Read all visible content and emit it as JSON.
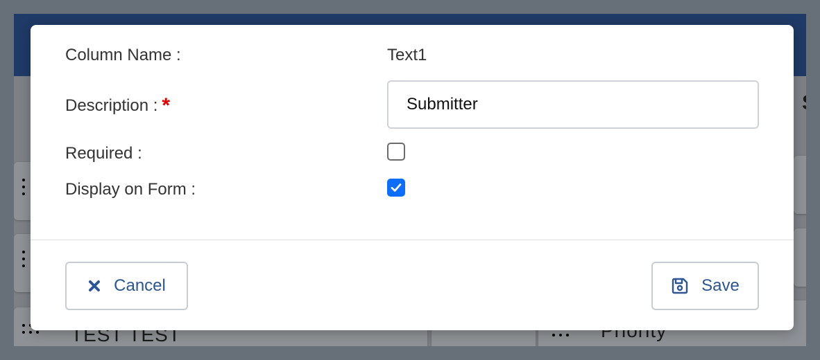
{
  "background": {
    "row_text_1": "TEST TEST",
    "row_text_2": "Priority",
    "partial_letter": "S"
  },
  "modal": {
    "column_name": {
      "label": "Column Name :",
      "value": "Text1"
    },
    "description": {
      "label": "Description :",
      "required_marker": "*",
      "value": "Submitter"
    },
    "required": {
      "label": "Required :",
      "checked": false
    },
    "display_on_form": {
      "label": "Display on Form :",
      "checked": true
    },
    "footer": {
      "cancel_label": "Cancel",
      "cancel_icon": "times-icon",
      "save_label": "Save",
      "save_icon": "floppy-disk-icon"
    }
  },
  "colors": {
    "accent": "#2c5596",
    "checkbox_checked": "#0d6efd",
    "required_star": "#e00000",
    "header_bg": "#1f3a66"
  }
}
